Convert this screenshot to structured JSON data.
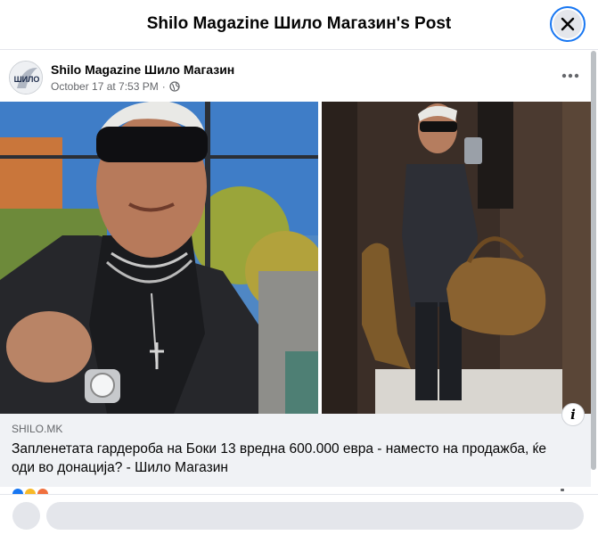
{
  "dialog": {
    "title": "Shilo Magazine Шило Магазин's Post",
    "close_icon": "close-icon"
  },
  "post": {
    "author": "Shilo Magazine Шило Магазин",
    "avatar_logo_text": "ШИЛО",
    "timestamp": "October 17 at 7:53 PM",
    "separator": "·",
    "audience_icon": "globe-icon",
    "more_icon": "more-horizontal-icon",
    "photos": [
      {
        "alt": "Man in sunglasses and black jacket, selfie on terrace"
      },
      {
        "alt": "Man holding suede bag, mirror selfie in elevator"
      }
    ]
  },
  "link_preview": {
    "domain": "SHILO.MK",
    "title": "Запленетата гардероба на Боки 13 вредна 600.000 евра - наместо на продажба, ќе оди во донација? - Шило Магазин",
    "info_icon": "info-icon"
  },
  "comment": {
    "placeholder": ""
  },
  "colors": {
    "accent": "#1877f2",
    "text_secondary": "#65676b",
    "card_bg": "#f0f2f5"
  }
}
